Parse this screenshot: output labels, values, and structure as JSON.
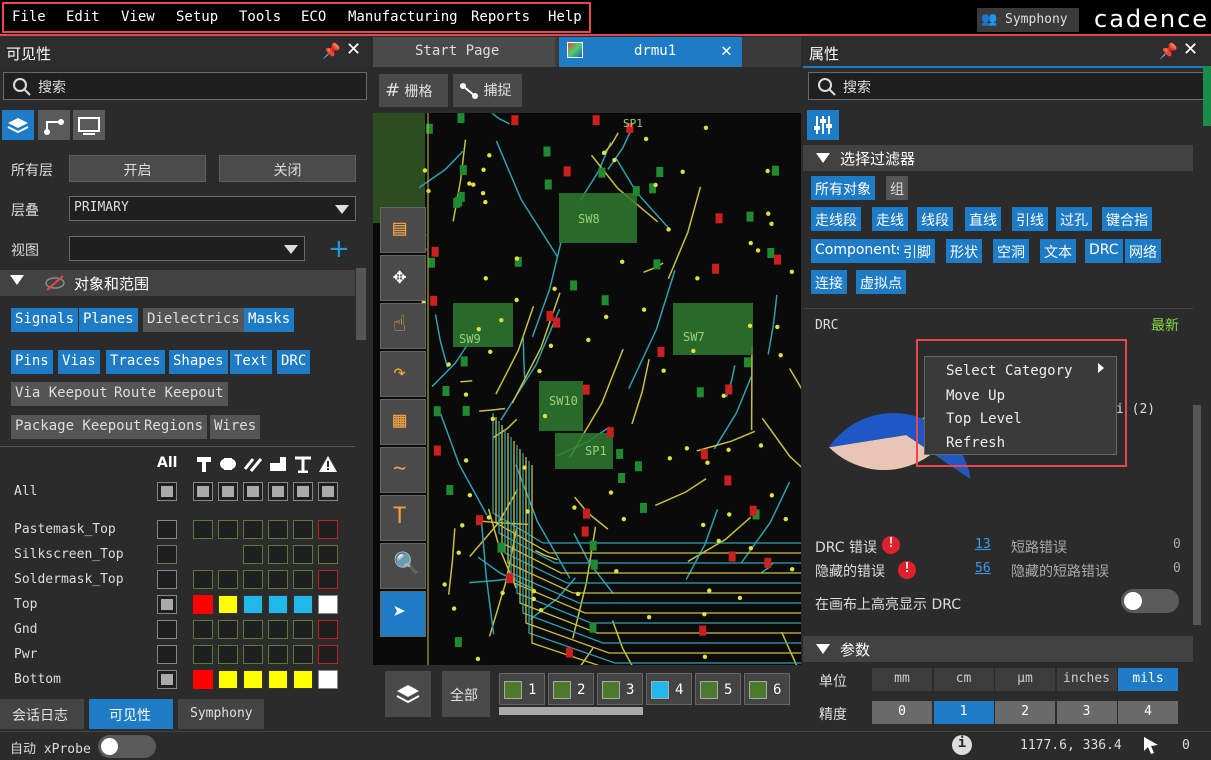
{
  "menu": {
    "items": [
      "File",
      "Edit",
      "View",
      "Setup",
      "Tools",
      "ECO",
      "Manufacturing",
      "Reports",
      "Help"
    ]
  },
  "header": {
    "symphony_label": "Symphony",
    "logo_text": "cadence"
  },
  "visibility_panel": {
    "title": "可见性",
    "search_placeholder": "搜索",
    "all_layers_label": "所有层",
    "on_label": "开启",
    "off_label": "关闭",
    "stack_label": "层叠",
    "stack_value": "PRIMARY",
    "view_label": "视图",
    "view_value": "",
    "section_title": "对象和范围",
    "filters_row1": [
      "Signals",
      "Planes",
      "Dielectrics",
      "Masks"
    ],
    "filters_row1_state": [
      "on",
      "on",
      "off",
      "on"
    ],
    "filters_row2": [
      "Pins",
      "Vias",
      "Traces",
      "Shapes",
      "Text",
      "DRC"
    ],
    "filters_row3": [
      "Via Keepout",
      "Route Keepout"
    ],
    "filters_row4": [
      "Package Keepout",
      "Regions",
      "Wires"
    ],
    "all_header": "All",
    "layers": [
      {
        "name": "All"
      },
      {
        "name": "Pastemask_Top"
      },
      {
        "name": "Silkscreen_Top"
      },
      {
        "name": "Soldermask_Top"
      },
      {
        "name": "Top",
        "colors": [
          "#ff0000",
          "#ffff00",
          "#1fb8e8",
          "#1fb8e8",
          "#1fb8e8",
          "#ffffff"
        ]
      },
      {
        "name": "Gnd"
      },
      {
        "name": "Pwr"
      },
      {
        "name": "Bottom",
        "colors": [
          "#ff0000",
          "#ffff00",
          "#ffff00",
          "#ffff00",
          "#ffff00",
          "#ffffff"
        ]
      }
    ]
  },
  "bottom_tabs": [
    "会话日志",
    "可见性",
    "Symphony"
  ],
  "tabs": {
    "start_page": "Start Page",
    "design": "drmu1"
  },
  "canvas_toolbar": {
    "grid_label": "栅格",
    "snap_label": "捕捉"
  },
  "canvas_labels": [
    "SW8",
    "SW7",
    "SW9",
    "SW10",
    "SP1"
  ],
  "layer_bar": {
    "all_label": "全部",
    "layers": [
      "1",
      "2",
      "3",
      "4",
      "5",
      "6"
    ]
  },
  "properties_panel": {
    "title": "属性",
    "search_placeholder": "搜索",
    "filter_section_title": "选择过滤器",
    "filter_row1": [
      "所有对象",
      "组"
    ],
    "filter_row2": [
      "走线段",
      "走线",
      "线段",
      "直线",
      "引线",
      "过孔",
      "键合指"
    ],
    "filter_row3": [
      "Components",
      "引脚",
      "形状",
      "空洞",
      "文本",
      "DRC",
      "网络"
    ],
    "filter_row4": [
      "连接",
      "虚拟点"
    ],
    "drc_label": "DRC",
    "latest_label": "最新",
    "pie_partial_label": "i (2)",
    "drc_errors_label": "DRC 错误",
    "drc_errors_count": "13",
    "short_errors_label": "短路错误",
    "short_errors_count": "0",
    "hidden_errors_label": "隐藏的错误",
    "hidden_errors_count": "56",
    "hidden_short_label": "隐藏的短路错误",
    "hidden_short_count": "0",
    "highlight_label": "在画布上高亮显示 DRC",
    "params_title": "参数",
    "units_label": "单位",
    "units": [
      "mm",
      "cm",
      "μm",
      "inches",
      "mils"
    ],
    "units_selected": "mils",
    "precision_label": "精度",
    "precision": [
      "0",
      "1",
      "2",
      "3",
      "4"
    ],
    "precision_selected": "1"
  },
  "pie": {
    "slices": [
      {
        "color": "#e8c5b4",
        "fraction": 0.4
      },
      {
        "color": "#b8c020",
        "fraction": 0.22
      },
      {
        "color": "#1f57c7",
        "fraction": 0.38
      }
    ]
  },
  "context_menu": {
    "items": [
      "Select Category",
      "Move Up",
      "Top Level",
      "Refresh"
    ]
  },
  "status_bar": {
    "auto_xprobe": "自动 xProbe",
    "coords": "1177.6, 336.4",
    "count": "0"
  }
}
